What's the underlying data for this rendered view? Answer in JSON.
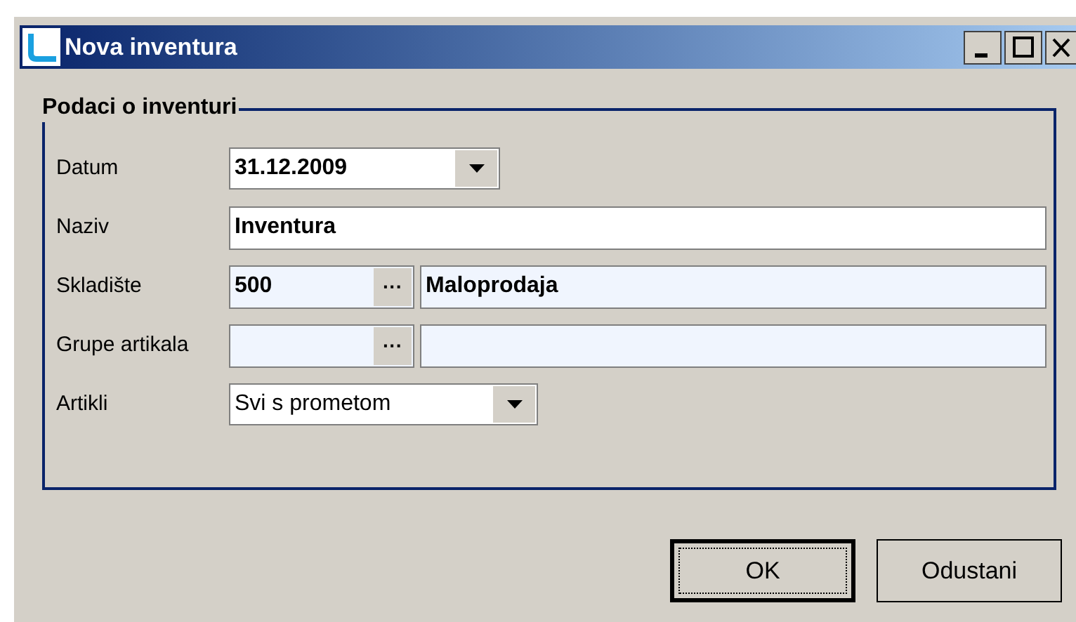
{
  "window": {
    "title": "Nova inventura"
  },
  "group": {
    "title": "Podaci o inventuri"
  },
  "fields": [
    {
      "kind": "combo",
      "label": "Datum",
      "value": "31.12.2009",
      "bold": true
    },
    {
      "kind": "text",
      "label": "Naziv",
      "value": "Inventura",
      "bold": true
    },
    {
      "kind": "lookup",
      "label": "Skladište",
      "code": "500",
      "name": "Maloprodaja",
      "button": "···"
    },
    {
      "kind": "lookup",
      "label": "Grupe artikala",
      "button": "···"
    },
    {
      "kind": "combo",
      "label": "Artikli",
      "value": "Svi s prometom",
      "bold": false
    }
  ],
  "buttons": [
    {
      "label": "OK",
      "default": true
    },
    {
      "label": "Odustani",
      "default": false
    }
  ]
}
